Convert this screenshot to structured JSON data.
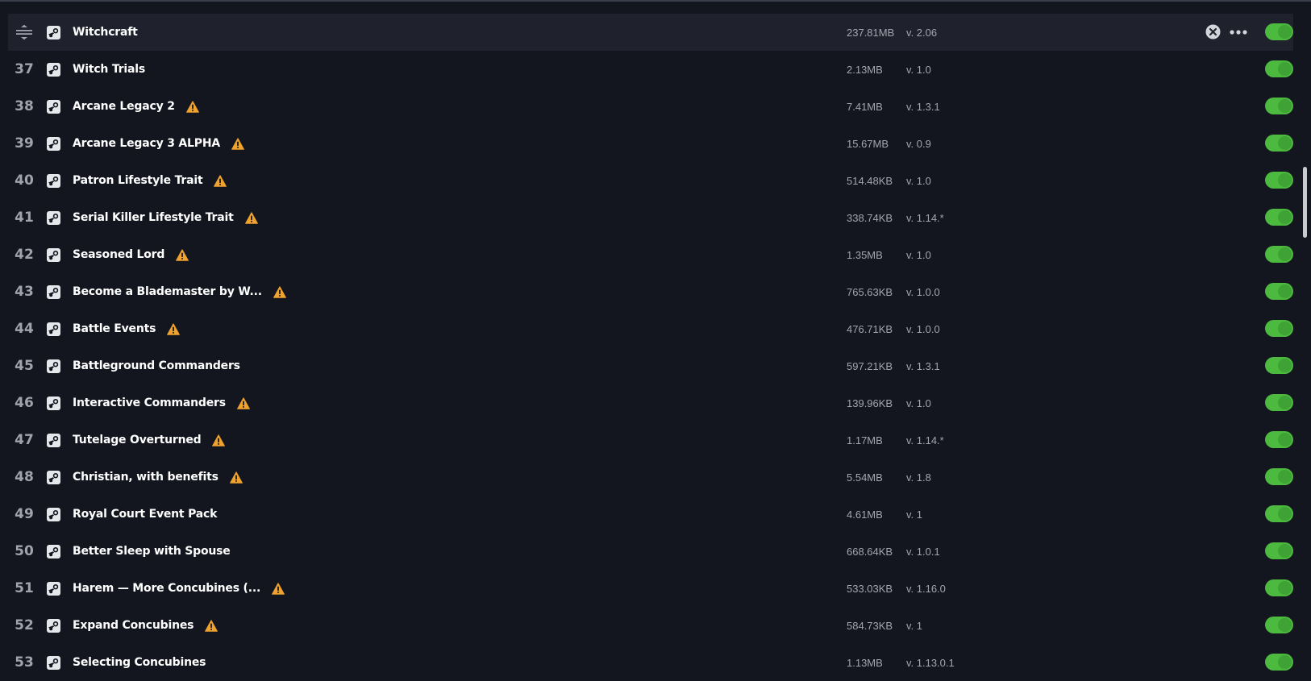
{
  "colors": {
    "background": "#13151f",
    "selected_row": "#1f222d",
    "toggle_on": "#4bba3e",
    "warning": "#f0a22e",
    "muted_text": "#a3a6ae"
  },
  "mods": [
    {
      "number": "",
      "name": "Witchcraft",
      "size": "237.81MB",
      "version": "v. 2.06",
      "warning": false,
      "enabled": true,
      "selected": true
    },
    {
      "number": "37",
      "name": "Witch Trials",
      "size": "2.13MB",
      "version": "v. 1.0",
      "warning": false,
      "enabled": true
    },
    {
      "number": "38",
      "name": "Arcane Legacy 2",
      "size": "7.41MB",
      "version": "v. 1.3.1",
      "warning": true,
      "enabled": true
    },
    {
      "number": "39",
      "name": "Arcane Legacy 3 ALPHA",
      "size": "15.67MB",
      "version": "v. 0.9",
      "warning": true,
      "enabled": true
    },
    {
      "number": "40",
      "name": "Patron Lifestyle Trait",
      "size": "514.48KB",
      "version": "v. 1.0",
      "warning": true,
      "enabled": true
    },
    {
      "number": "41",
      "name": "Serial Killer Lifestyle Trait",
      "size": "338.74KB",
      "version": "v. 1.14.*",
      "warning": true,
      "enabled": true
    },
    {
      "number": "42",
      "name": "Seasoned Lord",
      "size": "1.35MB",
      "version": "v. 1.0",
      "warning": true,
      "enabled": true
    },
    {
      "number": "43",
      "name": "Become a Blademaster by W...",
      "size": "765.63KB",
      "version": "v. 1.0.0",
      "warning": true,
      "enabled": true
    },
    {
      "number": "44",
      "name": "Battle Events",
      "size": "476.71KB",
      "version": "v. 1.0.0",
      "warning": true,
      "enabled": true
    },
    {
      "number": "45",
      "name": "Battleground Commanders",
      "size": "597.21KB",
      "version": "v. 1.3.1",
      "warning": false,
      "enabled": true
    },
    {
      "number": "46",
      "name": "Interactive Commanders",
      "size": "139.96KB",
      "version": "v. 1.0",
      "warning": true,
      "enabled": true
    },
    {
      "number": "47",
      "name": "Tutelage Overturned",
      "size": "1.17MB",
      "version": "v. 1.14.*",
      "warning": true,
      "enabled": true
    },
    {
      "number": "48",
      "name": "Christian, with benefits",
      "size": "5.54MB",
      "version": "v. 1.8",
      "warning": true,
      "enabled": true
    },
    {
      "number": "49",
      "name": "Royal Court Event Pack",
      "size": "4.61MB",
      "version": "v. 1",
      "warning": false,
      "enabled": true
    },
    {
      "number": "50",
      "name": "Better Sleep with Spouse",
      "size": "668.64KB",
      "version": "v. 1.0.1",
      "warning": false,
      "enabled": true
    },
    {
      "number": "51",
      "name": "Harem — More Concubines (...",
      "size": "533.03KB",
      "version": "v. 1.16.0",
      "warning": true,
      "enabled": true
    },
    {
      "number": "52",
      "name": "Expand Concubines",
      "size": "584.73KB",
      "version": "v. 1",
      "warning": true,
      "enabled": true
    },
    {
      "number": "53",
      "name": "Selecting Concubines",
      "size": "1.13MB",
      "version": "v. 1.13.0.1",
      "warning": false,
      "enabled": true
    }
  ]
}
